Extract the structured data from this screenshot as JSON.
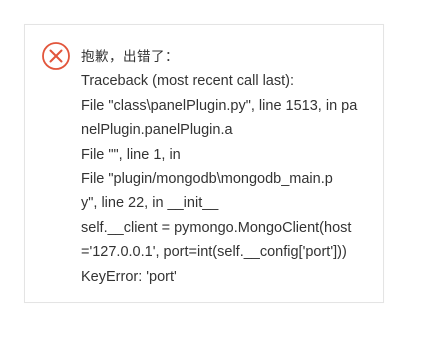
{
  "colors": {
    "error_icon": "#e2553b",
    "text": "#333333",
    "border": "#e4e4e4"
  },
  "dialog": {
    "icon": "error-circle-x-icon",
    "title": "抱歉，出错了：",
    "lines": [
      "Traceback (most recent call last):",
      "File \"class\\panelPlugin.py\", line 1513, in pa",
      "nelPlugin.panelPlugin.a",
      "File \"\", line 1, in",
      "File \"plugin/mongodb\\mongodb_main.p",
      "y\", line 22, in __init__",
      "self.__client = pymongo.MongoClient(host",
      "='127.0.0.1', port=int(self.__config['port']))",
      "KeyError: 'port'"
    ]
  }
}
